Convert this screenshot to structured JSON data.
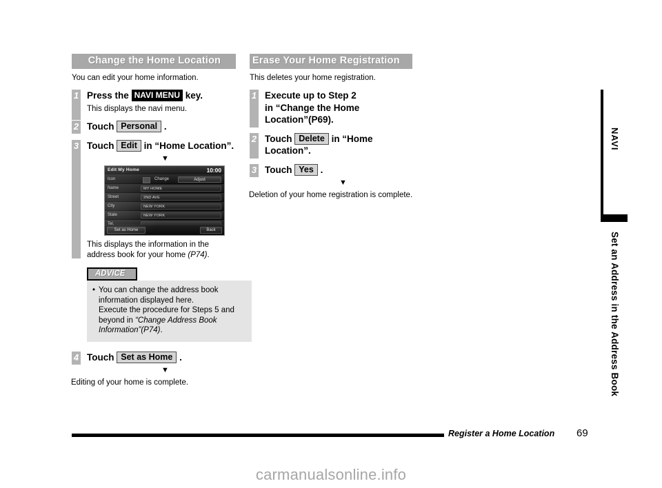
{
  "document": {
    "footer": {
      "section_title": "Register a Home Location",
      "page_number": "69",
      "watermark": "carmanualsonline.info"
    },
    "side_tab": {
      "label": "NAVI",
      "chapter": "Set an Address in the Address Book"
    }
  },
  "left_column": {
    "heading": "Change the Home Location",
    "intro": "You can edit your home information.",
    "steps": [
      {
        "number": "1",
        "text_before": "Press the",
        "key_label": "NAVI MENU",
        "text_after": "key.",
        "sub": "This displays the navi menu."
      },
      {
        "number": "2",
        "text_before": "Touch",
        "button_label": "Personal",
        "text_after": "."
      },
      {
        "number": "3",
        "text_before": "Touch",
        "button_label": "Edit",
        "text_after": "in “Home Location”.",
        "arrow": "▼",
        "caption_plain": "This displays the information in the address book for your home ",
        "caption_italic": "(P74)",
        "caption_end": "."
      },
      {
        "number": "4",
        "text_before": "Touch",
        "button_label": "Set as Home",
        "text_after": ".",
        "arrow": "▼"
      }
    ],
    "advice": {
      "label": "ADVICE",
      "bullet_part1": "You can change the address book information displayed here.",
      "bullet_part2": "Execute the procedure for Steps 5 and beyond in ",
      "bullet_italic": "“Change Address Book Information”(P74)",
      "bullet_end": "."
    },
    "closing": "Editing of your home is complete."
  },
  "nav_screen": {
    "title": "Edit My Home",
    "clock": "10:00",
    "icon_row": {
      "label": "Icon",
      "change_label": "Change",
      "adjust_label": "Adjust"
    },
    "fields": [
      {
        "label": "Name",
        "value": "MY HOME"
      },
      {
        "label": "Street",
        "value": "2ND AVE"
      },
      {
        "label": "City",
        "value": "NEW YORK"
      },
      {
        "label": "State",
        "value": "NEW YORK"
      },
      {
        "label": "Tel.",
        "value": ""
      }
    ],
    "set_as_home_label": "Set as Home",
    "back_label": "Back"
  },
  "right_column": {
    "heading": "Erase Your Home Registration",
    "intro": "This deletes your home registration.",
    "steps": [
      {
        "number": "1",
        "line1": "Execute up to Step 2",
        "line2_plain": "in ",
        "line2_italic": "“Change the Home Location”(P69)",
        "line2_end": "."
      },
      {
        "number": "2",
        "text_before": "Touch",
        "button_label": "Delete",
        "text_after": "in “Home Location”."
      },
      {
        "number": "3",
        "text_before": "Touch",
        "button_label": "Yes",
        "text_after": ".",
        "arrow": "▼"
      }
    ],
    "closing": "Deletion of your home registration is complete."
  }
}
